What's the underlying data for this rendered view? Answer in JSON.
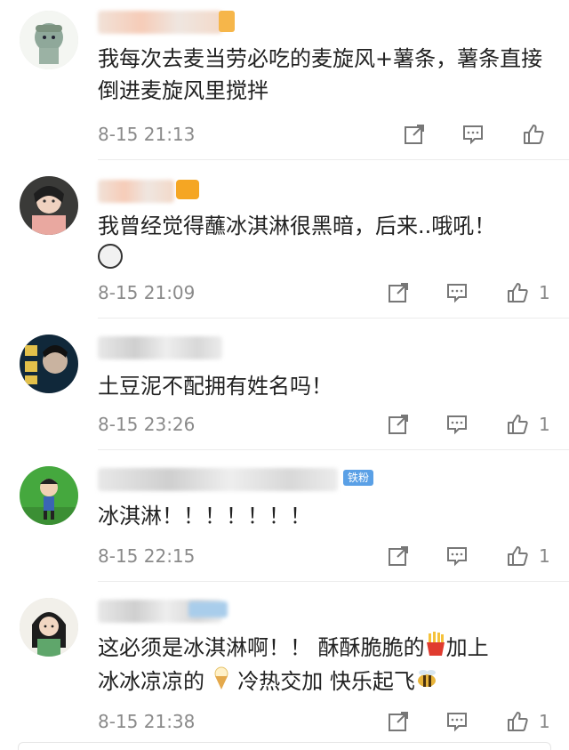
{
  "comments": [
    {
      "text": "我每次去麦当劳必吃的麦旋风+薯条，薯条直接倒进麦旋风里搅拌",
      "time": "8-15 21:13",
      "likes": ""
    },
    {
      "text": "我曾经觉得蘸冰淇淋很黑暗，后来..哦吼！",
      "time": "8-15 21:09",
      "likes": "1"
    },
    {
      "text": "土豆泥不配拥有姓名吗！",
      "time": "8-15 23:26",
      "likes": "1"
    },
    {
      "badge": "铁粉",
      "text": "冰淇淋！！！！！！！",
      "time": "8-15 22:15",
      "likes": "1"
    },
    {
      "text_a": "这必须是冰淇淋啊！！ 酥酥脆脆的",
      "text_b": "加上",
      "text_c": "冰冰凉凉的",
      "text_d": "冷热交加 快乐起飞",
      "time": "8-15 21:38",
      "likes": "1"
    }
  ],
  "icons": {
    "share": "share-icon",
    "comment": "comment-icon",
    "like": "like-icon"
  }
}
